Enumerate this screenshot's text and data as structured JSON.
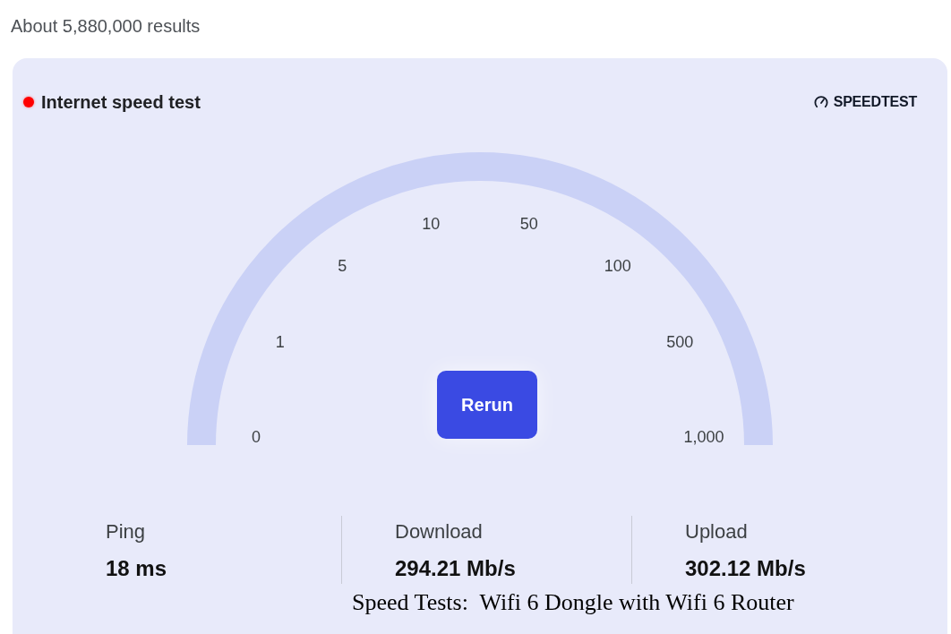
{
  "results_count": "About 5,880,000 results",
  "widget": {
    "title": "Internet speed test",
    "brand": "SPEEDTEST",
    "gauge": {
      "scale_labels": [
        "0",
        "1",
        "5",
        "10",
        "50",
        "100",
        "500",
        "1,000"
      ],
      "button": "Rerun"
    },
    "stats": [
      {
        "label": "Ping",
        "value": "18 ms"
      },
      {
        "label": "Download",
        "value": "294.21 Mb/s"
      },
      {
        "label": "Upload",
        "value": "302.12 Mb/s"
      }
    ]
  },
  "caption": "Speed Tests:  Wifi 6 Dongle with Wifi 6 Router"
}
